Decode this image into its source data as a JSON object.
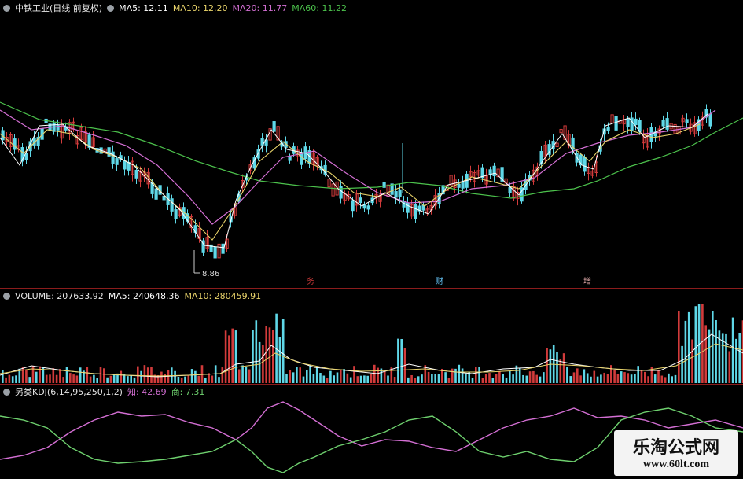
{
  "price_pane": {
    "stock_title": "中铁工业(日线 前复权)",
    "ma5_label": "MA5: 12.11",
    "ma10_label": "MA10: 12.20",
    "ma20_label": "MA20: 11.77",
    "ma60_label": "MA60: 11.22",
    "low_marker": "8.86",
    "event_markers": [
      "务",
      "财",
      "增"
    ]
  },
  "volume_pane": {
    "volume_label": "VOLUME: 207633.92",
    "ma5_label": "MA5: 240648.36",
    "ma10_label": "MA10: 280459.91"
  },
  "kdj_pane": {
    "indicator_label": "另类KDJ(6,14,95,250,1,2)",
    "zhi_label": "知: 42.69",
    "shang_label": "商: 7.31"
  },
  "watermark": {
    "cn_text": "乐淘公式网",
    "url_text": "www.60lt.com"
  },
  "colors": {
    "up": "#d23b3b",
    "down": "#5fd8e8",
    "ma5": "#ffffff",
    "ma10": "#e8d36a",
    "ma20": "#d46fd4",
    "ma60": "#4cc24c",
    "kdj_k": "#d46fd4",
    "kdj_d": "#6ed06e"
  }
}
